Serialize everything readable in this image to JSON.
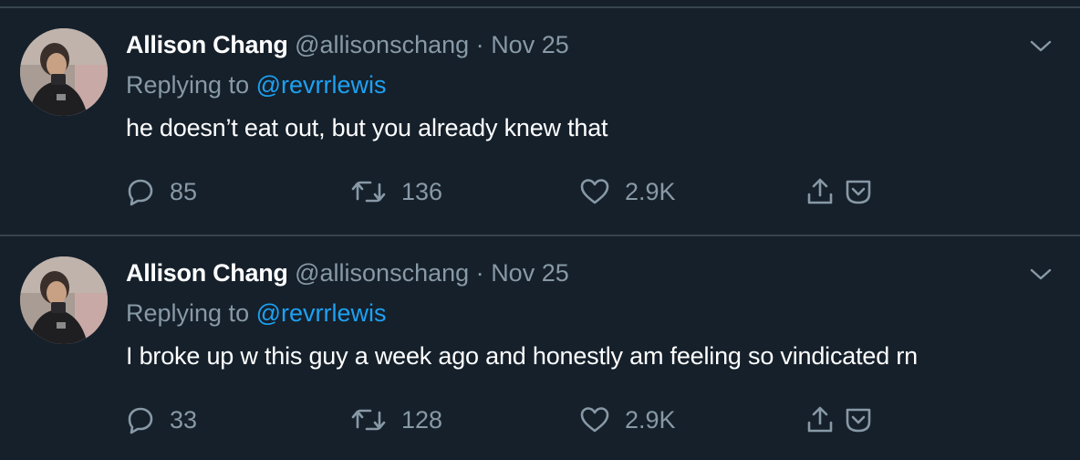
{
  "colors": {
    "background": "#15202b",
    "divider": "#38444d",
    "secondary_text": "#8899a6",
    "link": "#1da1f2",
    "primary_text": "#ffffff"
  },
  "tweets": [
    {
      "author_name": "Allison Chang",
      "handle": "@allisonschang",
      "separator": "·",
      "date": "Nov 25",
      "replying_prefix": "Replying to",
      "replying_to": "@revrrlewis",
      "text": "he doesn’t eat out, but you already knew that",
      "replies": "85",
      "retweets": "136",
      "likes": "2.9K"
    },
    {
      "author_name": "Allison Chang",
      "handle": "@allisonschang",
      "separator": "·",
      "date": "Nov 25",
      "replying_prefix": "Replying to",
      "replying_to": "@revrrlewis",
      "text": "I broke up w this guy a week ago and honestly am feeling so vindicated rn",
      "replies": "33",
      "retweets": "128",
      "likes": "2.9K"
    }
  ],
  "icons": [
    "chevron-down-icon",
    "reply-icon",
    "retweet-icon",
    "like-icon",
    "share-icon",
    "bookmark-icon"
  ]
}
